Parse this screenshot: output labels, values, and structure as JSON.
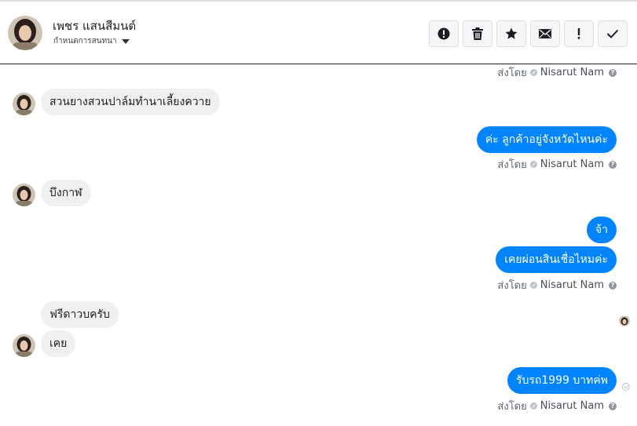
{
  "header": {
    "contact_name": "เพชร แสนสีมนต์",
    "subtitle": "กำหนดการสนทนา"
  },
  "toolbar": {
    "buttons": [
      "alert-circle-icon",
      "trash-icon",
      "star-icon",
      "envelope-icon",
      "exclamation-icon",
      "check-icon"
    ]
  },
  "sent_by_label": "ส่งโดย",
  "agent_name": "Nisarut Nam",
  "messages": [
    {
      "direction": "incoming",
      "text": "สวนยางสวนปาล์มทำนาเลี้ยงควาย"
    },
    {
      "direction": "outgoing",
      "text": "ค่ะ ลูกค้าอยู่จังหวัดไหนค่ะ"
    },
    {
      "direction": "incoming",
      "text": "บึงกาฬ"
    },
    {
      "direction": "outgoing",
      "text": "จ้า"
    },
    {
      "direction": "outgoing",
      "text": "เคยผ่อนสินเชื่อไหมค่ะ"
    },
    {
      "direction": "incoming",
      "text": "ฟรีดาวบครับ"
    },
    {
      "direction": "incoming",
      "text": "เคย"
    },
    {
      "direction": "outgoing",
      "text": "รับรถ1999 บาทค่พ"
    }
  ],
  "colors": {
    "outgoing_bubble": "#0084ff",
    "incoming_bubble": "#f1f0f0",
    "meta_text": "#606770"
  }
}
